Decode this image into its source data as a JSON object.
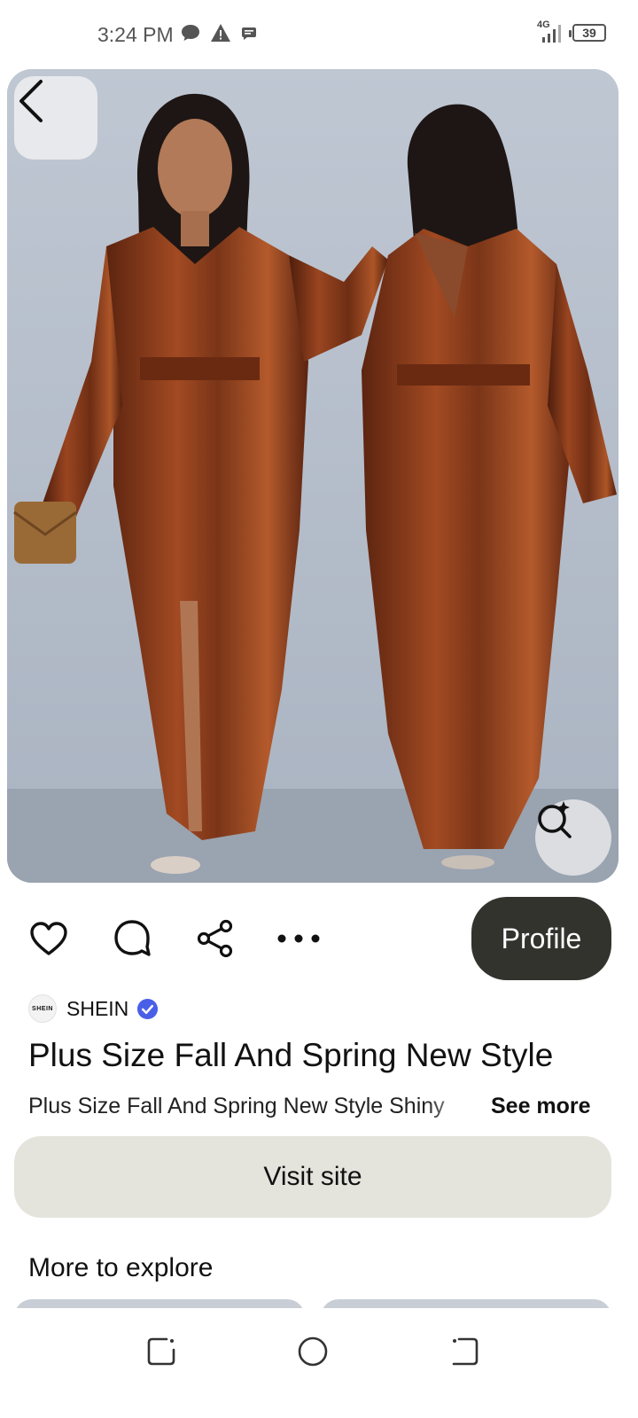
{
  "status_bar": {
    "time": "3:24 PM",
    "network": "4G",
    "battery": "39"
  },
  "pin": {
    "image_alt": "Brown satin long-sleeve maxi dress, front and back views",
    "brand_name": "SHEIN",
    "brand_logo_text": "SHEIN",
    "title": "Plus Size Fall And Spring New Style",
    "description": "Plus Size Fall And Spring New Style Shiny",
    "see_more_label": "See more"
  },
  "actions": {
    "profile_label": "Profile",
    "visit_site_label": "Visit site"
  },
  "more_to_explore": {
    "heading": "More to explore"
  },
  "icons": {
    "back": "chevron-left-icon",
    "lens": "visual-search-icon",
    "like": "heart-icon",
    "comment": "comment-bubble-icon",
    "share": "share-icon",
    "more": "ellipsis-icon",
    "verified": "verified-badge-icon",
    "nav_recent": "recents-icon",
    "nav_home": "home-circle-icon",
    "nav_back": "back-icon"
  },
  "colors": {
    "profile_button": "#33332e",
    "visit_button": "#e4e4dd",
    "verified": "#4a5fe8",
    "dress": "#7a3518"
  }
}
